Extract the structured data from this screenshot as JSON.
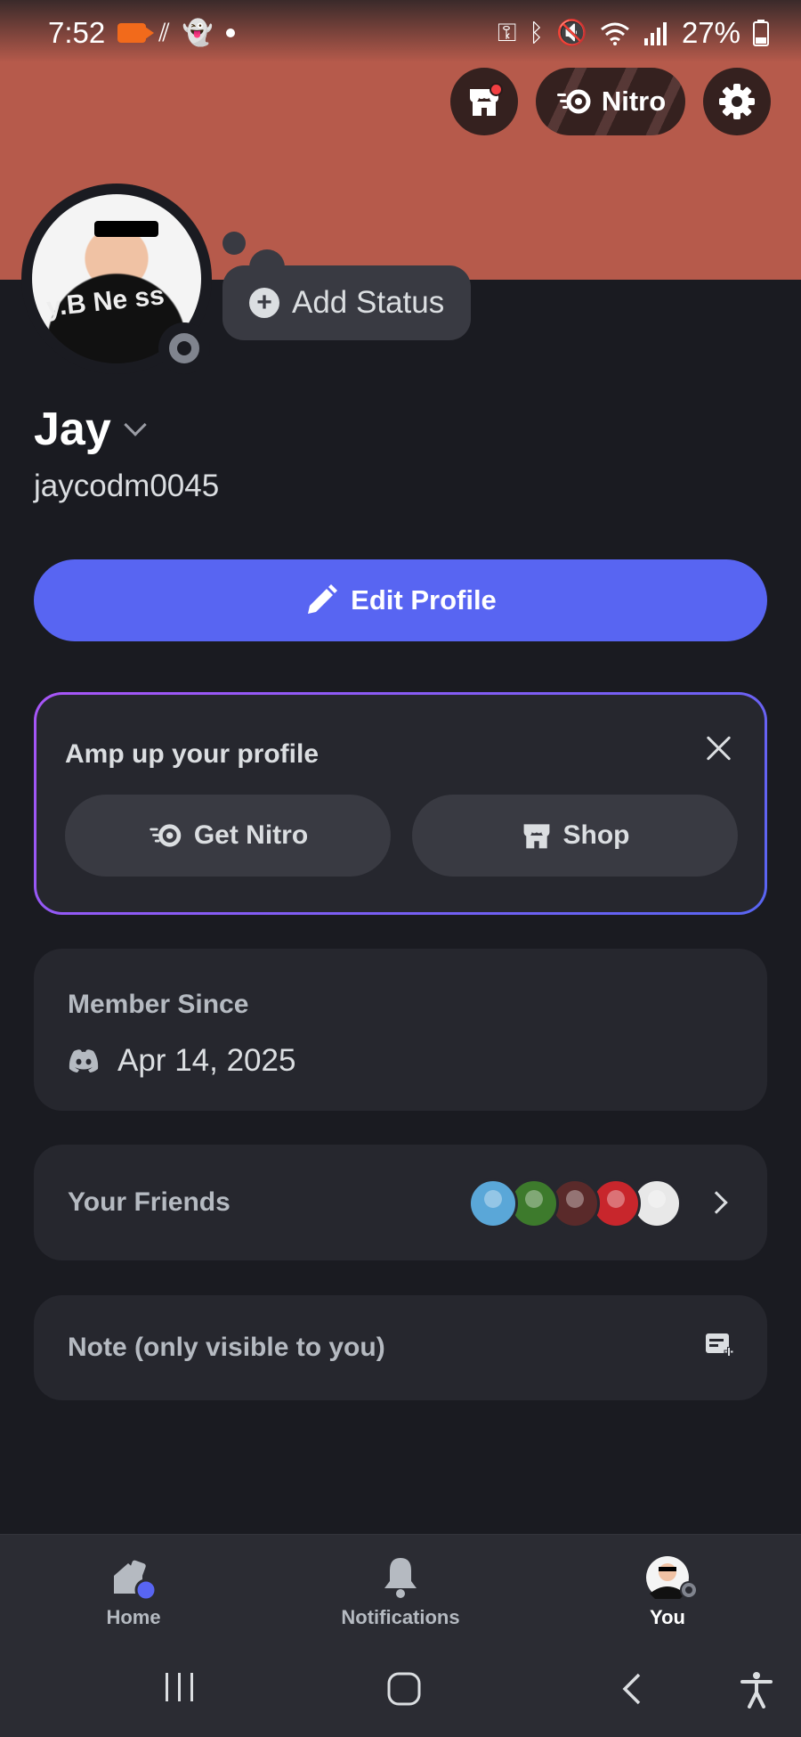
{
  "status_bar": {
    "time": "7:52",
    "battery": "27%",
    "icons": [
      "video-recording-icon",
      "wifi-calling-icon",
      "snapchat-icon",
      "key-icon",
      "bluetooth-icon",
      "mute-icon",
      "wifi-icon",
      "signal-icon",
      "battery-icon"
    ]
  },
  "header": {
    "nitro_label": "Nitro",
    "shop_icon": "shop-icon",
    "settings_icon": "gear-icon",
    "banner_color": "#b65a4b"
  },
  "profile": {
    "add_status_label": "Add Status",
    "display_name": "Jay",
    "username": "jaycodm0045",
    "avatar_text": "y.B  Ne  ss",
    "presence": "offline"
  },
  "edit_profile": {
    "label": "Edit Profile",
    "color": "#5865f2"
  },
  "amp_card": {
    "title": "Amp up your profile",
    "get_nitro_label": "Get Nitro",
    "shop_label": "Shop"
  },
  "member_since": {
    "label": "Member Since",
    "date": "Apr 14, 2025"
  },
  "friends": {
    "label": "Your Friends",
    "avatar_colors": [
      "#5aa7d8",
      "#3d7a2c",
      "#5a2a2a",
      "#c8262c",
      "#e8e8e8"
    ]
  },
  "note": {
    "placeholder": "Note (only visible to you)"
  },
  "bottom_nav": {
    "home": "Home",
    "notifications": "Notifications",
    "you": "You",
    "active": "You"
  }
}
